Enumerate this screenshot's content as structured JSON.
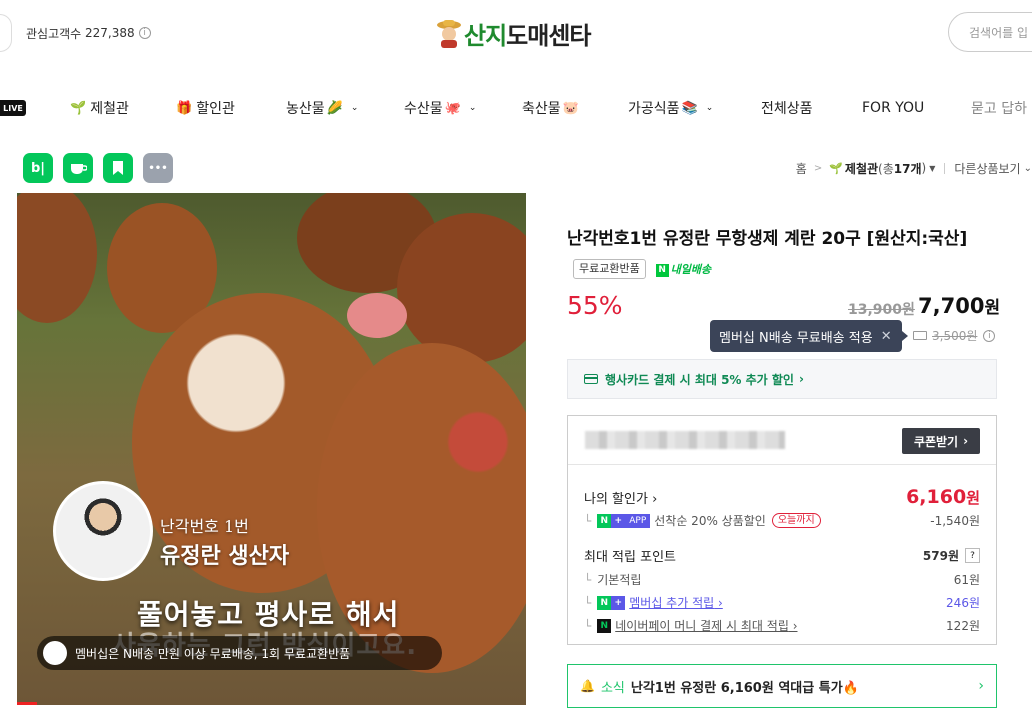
{
  "header": {
    "visitors_label": "관심고객수",
    "visitors_count": "227,388",
    "logo_text_a": "산지",
    "logo_text_b": "도매센타",
    "search_placeholder": "검색어를 입"
  },
  "nav": {
    "live": "LIVE",
    "items": [
      {
        "label": "제철관",
        "emoji": "🌱"
      },
      {
        "label": "할인관",
        "emoji": "🎁"
      },
      {
        "label": "농산물",
        "emoji": "🌽"
      },
      {
        "label": "수산물",
        "emoji": "🐙"
      },
      {
        "label": "축산물",
        "emoji": "🐷"
      },
      {
        "label": "가공식품",
        "emoji": "📚"
      },
      {
        "label": "전체상품"
      },
      {
        "label": "FOR YOU"
      },
      {
        "label": "묻고 답하"
      }
    ]
  },
  "share": {
    "blog": "b|",
    "more": "•••"
  },
  "breadcrumb": {
    "home": "홈",
    "category": "제철관",
    "count_prefix": "(총 ",
    "count": "17개",
    "count_suffix": ")",
    "other": "다른상품보기"
  },
  "hero": {
    "subtitle": "난각번호 1번",
    "headline": "유정란 생산자",
    "caption": "풀어놓고 평사로 해서",
    "caption2": "사육하는 그런 방식이고요.",
    "banner": "멤버십은 N배송 만원 이상 무료배송, 1회 무료교환반품"
  },
  "product": {
    "title": "난각번호1번 유정란 무항생제 계란 20구 [원산지:국산]",
    "badge_free_return": "무료교환반품",
    "badge_delivery": "내일배송",
    "discount_rate": "55%",
    "original_price": "13,900원",
    "sale_price": "7,700",
    "won": "원",
    "tooltip": "멤버십 N배송 무료배송 적용",
    "shipping_fee": "3,500원"
  },
  "card_promo": "행사카드 결제 시 최대 5% 추가 할인",
  "benefit": {
    "coupon_button": "쿠폰받기",
    "my_price_label": "나의 할인가",
    "my_price_value": "6,160",
    "won": "원",
    "first_order_pill": "APP",
    "first_order_text": "선착순 20% 상품할인",
    "first_order_badge": "오늘까지",
    "first_order_value": "-1,540원",
    "points_label": "최대 적립 포인트",
    "points_value": "579원",
    "base_label": "기본적립",
    "base_value": "61원",
    "membership_label": "멤버십 추가 적립",
    "membership_value": "246원",
    "npay_label": "네이버페이 머니 결제 시 최대 적립",
    "npay_value": "122원"
  },
  "news": {
    "tag": "소식",
    "text": "난각1번 유정란 6,160원 역대급 특가🔥"
  },
  "colors": {
    "accent_red": "#e0203a",
    "naver_green": "#03c75a",
    "tooltip_bg": "#3b4458"
  }
}
